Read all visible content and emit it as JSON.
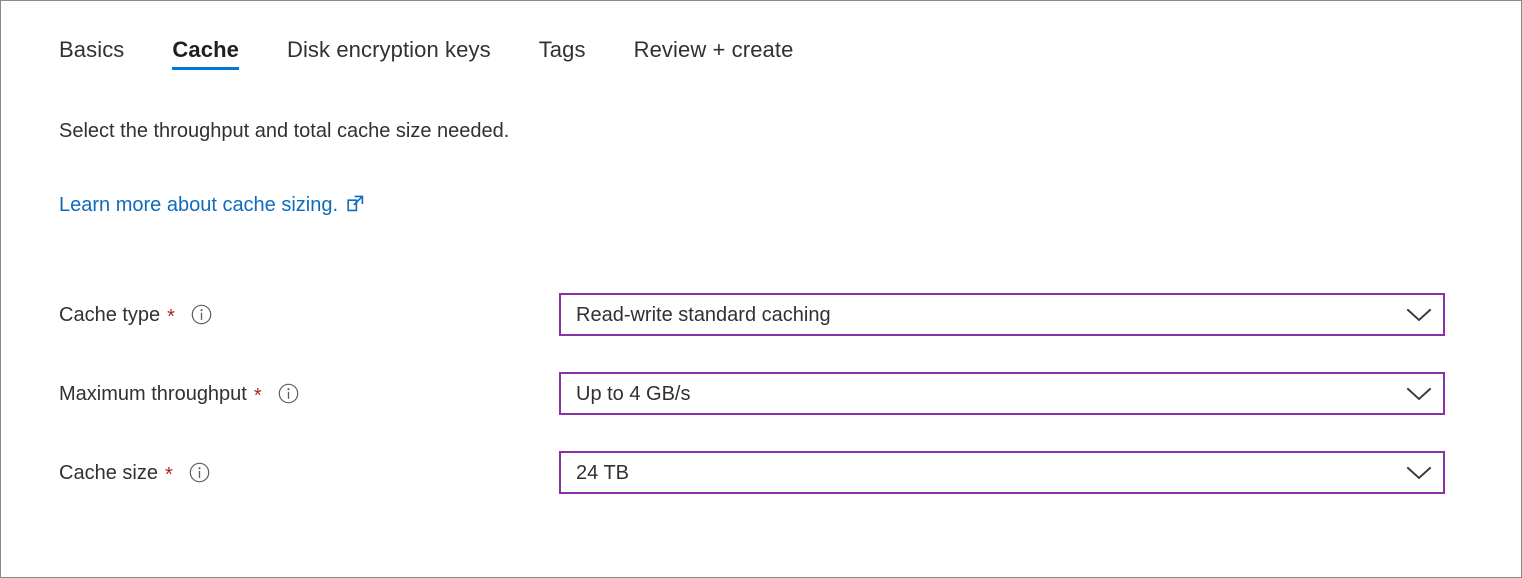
{
  "window": {
    "border_color": "#8a8a8a",
    "background": "#ffffff"
  },
  "tabs": {
    "selected": "Cache",
    "accent_color": "#0078d4",
    "items": [
      {
        "label": "Basics"
      },
      {
        "label": "Cache"
      },
      {
        "label": "Disk encryption keys"
      },
      {
        "label": "Tags"
      },
      {
        "label": "Review + create"
      }
    ]
  },
  "content": {
    "description": "Select the throughput and total cache size needed.",
    "link": {
      "text": "Learn more about cache sizing.",
      "icon": "external-link-icon",
      "color": "#0f6cbd"
    }
  },
  "form": {
    "required_marker": "*",
    "required_color": "#a4262c",
    "field_border_color": "#8b31a6",
    "info_icon": "info-icon",
    "chevron_icon": "chevron-down-icon",
    "fields": [
      {
        "label": "Cache type",
        "required": true,
        "value": "Read-write standard caching"
      },
      {
        "label": "Maximum throughput",
        "required": true,
        "value": "Up to 4 GB/s"
      },
      {
        "label": "Cache size",
        "required": true,
        "value": "24 TB"
      }
    ]
  }
}
